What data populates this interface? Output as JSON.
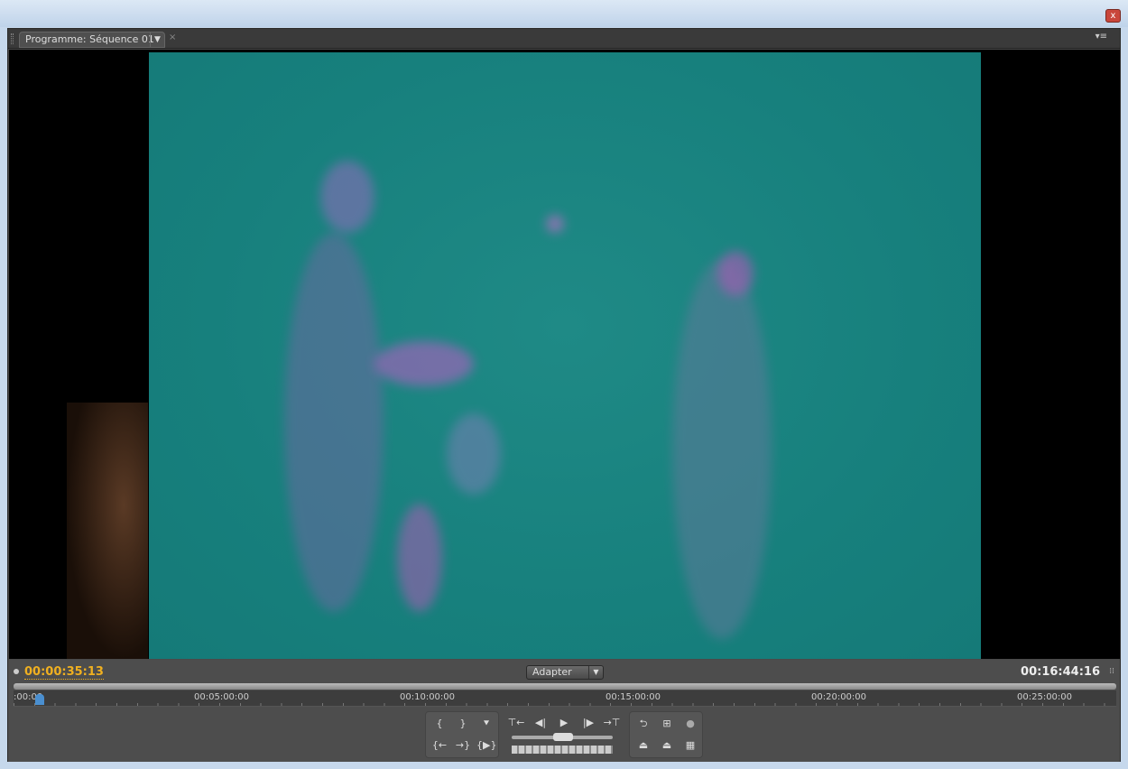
{
  "window": {
    "close_label": "x"
  },
  "panel": {
    "tab_label": "Programme: Séquence 01",
    "tab_dropdown": "▼",
    "tab_close": "×",
    "menu_icon": "▾≡"
  },
  "controls": {
    "current_timecode": "00:00:35:13",
    "fit_label": "Adapter",
    "fit_dropdown": "▼",
    "duration_timecode": "00:16:44:16",
    "ruler_labels": [
      ":00:00",
      "00:05:00:00",
      "00:10:00:00",
      "00:15:00:00",
      "00:20:00:00",
      "00:25:00:00"
    ]
  },
  "buttons": {
    "mark_in": "{",
    "mark_out": "}",
    "add_marker": "⯆",
    "go_to_in": "{←",
    "go_to_out": "→}",
    "play_in_to_out": "{▶}",
    "go_prev_edit": "⊤←",
    "step_back": "◀|",
    "play": "▶",
    "step_forward": "|▶",
    "go_next_edit": "→⊤",
    "loop": "⮌",
    "safe_margins": "⊞",
    "output": "●",
    "lift": "⏏",
    "extract": "⏏",
    "export_frame": "▦"
  }
}
